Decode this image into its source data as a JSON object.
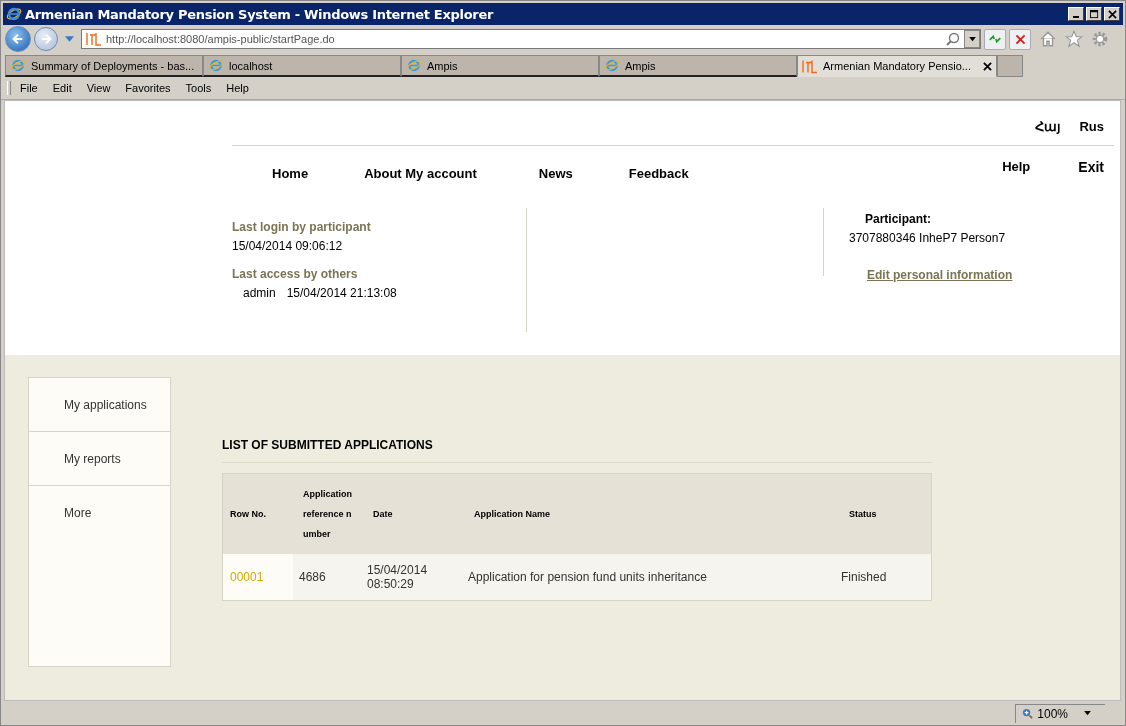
{
  "window": {
    "title": "Armenian Mandatory Pension System - Windows Internet Explorer"
  },
  "address_bar": {
    "url": "http://localhost:8080/ampis-public/startPage.do"
  },
  "tabs": [
    {
      "label": "Summary of Deployments - bas...",
      "selected": false,
      "kind": "ie"
    },
    {
      "label": "localhost",
      "selected": false,
      "kind": "ie"
    },
    {
      "label": "Ampis",
      "selected": false,
      "kind": "ie"
    },
    {
      "label": "Ampis",
      "selected": false,
      "kind": "ie"
    },
    {
      "label": "Armenian Mandatory Pensio...",
      "selected": true,
      "kind": "site"
    }
  ],
  "menu_bar": [
    "File",
    "Edit",
    "View",
    "Favorites",
    "Tools",
    "Help"
  ],
  "languages": [
    "Հայ",
    "Rus"
  ],
  "nav": [
    "Home",
    "About My account",
    "News",
    "Feedback"
  ],
  "nav_right": [
    "Help",
    "Exit"
  ],
  "last_login": {
    "label": "Last login by participant",
    "value": "15/04/2014 09:06:12"
  },
  "last_access": {
    "label": "Last access by others",
    "user": "admin",
    "value": "15/04/2014 21:13:08"
  },
  "participant": {
    "label": "Participant:",
    "value": "3707880346 InheP7 Person7",
    "link": "Edit personal information"
  },
  "sidebar": {
    "items": [
      "My applications",
      "My reports",
      "More"
    ]
  },
  "section_title": "LIST OF SUBMITTED APPLICATIONS",
  "table": {
    "columns": [
      "Row No.",
      "Application reference number",
      "Date",
      "Application Name",
      "Status"
    ],
    "rows": [
      [
        "00001",
        "4686",
        "15/04/2014 08:50:29",
        "Application for pension fund units inheritance",
        "Finished"
      ]
    ]
  },
  "status_bar": {
    "zoom": "100%"
  }
}
